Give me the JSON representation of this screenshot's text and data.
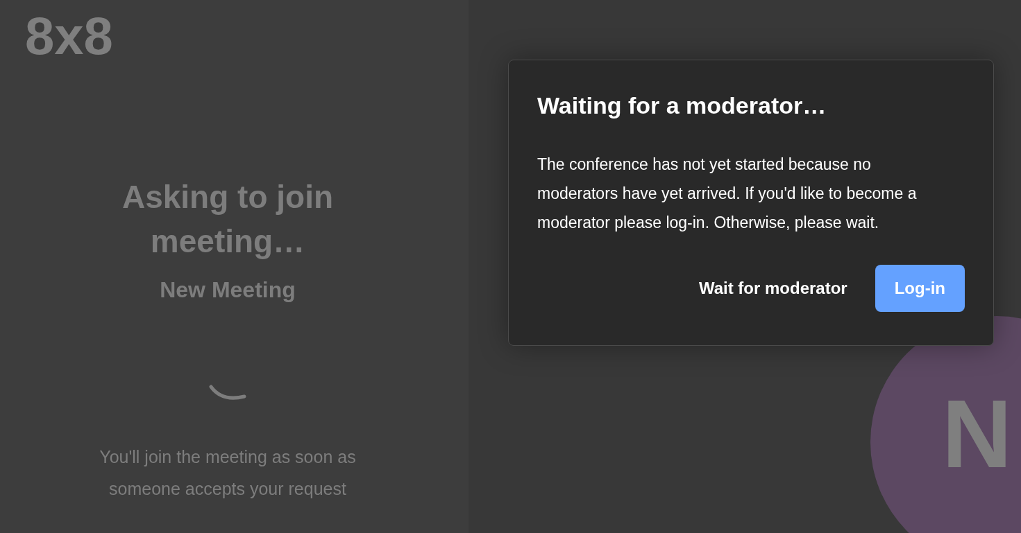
{
  "logo": "8x8",
  "lobby": {
    "title": "Asking to join meeting…",
    "meeting_name": "New Meeting",
    "message": "You'll join the meeting as soon as someone accepts your request"
  },
  "avatar": {
    "initial": "N",
    "color": "#5c4862"
  },
  "dialog": {
    "title": "Waiting for a moderator…",
    "body": "The conference has not yet started because no moderators have yet arrived. If you'd like to become a moderator please log-in. Otherwise, please wait.",
    "buttons": [
      {
        "label": "Wait for moderator",
        "kind": "text"
      },
      {
        "label": "Log-in",
        "kind": "primary"
      }
    ]
  }
}
